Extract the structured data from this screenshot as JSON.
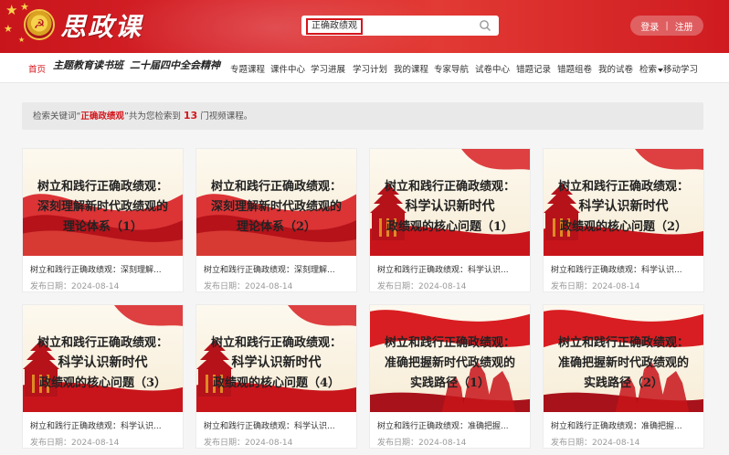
{
  "header": {
    "logo_text": "思政课",
    "search_term": "正确政绩观",
    "login": "登录",
    "auth_sep": "|",
    "register": "注册"
  },
  "nav": {
    "home": "首页",
    "slogan1": "主题教育读书班",
    "slogan2": "二十届四中全会精神",
    "items": [
      "专题课程",
      "课件中心",
      "学习进展",
      "学习计划",
      "我的课程",
      "专家导航",
      "试卷中心",
      "错题记录",
      "错题组卷",
      "我的试卷",
      "检索",
      "移动学习"
    ]
  },
  "result": {
    "prefix": "检索关键词“",
    "keyword": "正确政绩观",
    "middle": "”共为您检索到",
    "count": "13",
    "suffix": "门视频课程。"
  },
  "cards": [
    {
      "line1": "树立和践行正确政绩观：",
      "line2": "深刻理解新时代政绩观的",
      "line3": "理论体系（1）",
      "title": "树立和践行正确政绩观：深刻理解...",
      "date": "发布日期：2024-08-14"
    },
    {
      "line1": "树立和践行正确政绩观：",
      "line2": "深刻理解新时代政绩观的",
      "line3": "理论体系（2）",
      "title": "树立和践行正确政绩观：深刻理解...",
      "date": "发布日期：2024-08-14"
    },
    {
      "line1": "树立和践行正确政绩观：",
      "line2": "科学认识新时代",
      "line3": "政绩观的核心问题（1）",
      "title": "树立和践行正确政绩观：科学认识...",
      "date": "发布日期：2024-08-14"
    },
    {
      "line1": "树立和践行正确政绩观：",
      "line2": "科学认识新时代",
      "line3": "政绩观的核心问题（2）",
      "title": "树立和践行正确政绩观：科学认识...",
      "date": "发布日期：2024-08-14"
    },
    {
      "line1": "树立和践行正确政绩观：",
      "line2": "科学认识新时代",
      "line3": "政绩观的核心问题（3）",
      "title": "树立和践行正确政绩观：科学认识...",
      "date": "发布日期：2024-08-14"
    },
    {
      "line1": "树立和践行正确政绩观：",
      "line2": "科学认识新时代",
      "line3": "政绩观的核心问题（4）",
      "title": "树立和践行正确政绩观：科学认识...",
      "date": "发布日期：2024-08-14"
    },
    {
      "line1": "树立和践行正确政绩观：",
      "line2": "准确把握新时代政绩观的",
      "line3": "实践路径（1）",
      "title": "树立和践行正确政绩观：准确把握...",
      "date": "发布日期：2024-08-14"
    },
    {
      "line1": "树立和践行正确政绩观：",
      "line2": "准确把握新时代政绩观的",
      "line3": "实践路径（2）",
      "title": "树立和践行正确政绩观：准确把握...",
      "date": "发布日期：2024-08-14"
    }
  ]
}
